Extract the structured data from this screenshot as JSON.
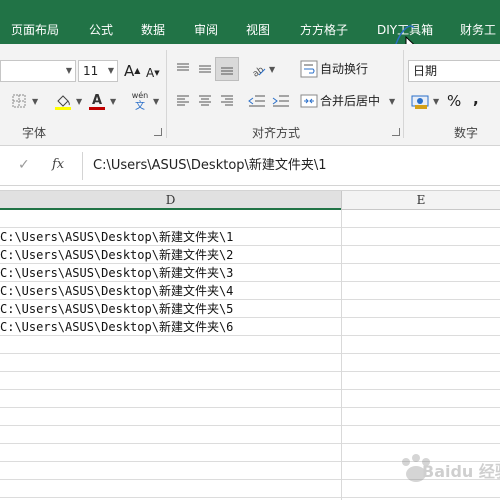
{
  "ribbon_tabs": [
    {
      "label": "页面布局"
    },
    {
      "label": "公式"
    },
    {
      "label": "数据"
    },
    {
      "label": "审阅"
    },
    {
      "label": "视图"
    },
    {
      "label": "方方格子"
    },
    {
      "label": "DIY工具箱"
    },
    {
      "label": "财务工"
    }
  ],
  "font": {
    "size": "11",
    "group_label": "字体",
    "grow_label": "A",
    "shrink_label": "A",
    "font_color_label": "A",
    "phonetic_label": "wén"
  },
  "alignment": {
    "wrap_text_label": "自动换行",
    "merge_center_label": "合并后居中",
    "group_label": "对齐方式"
  },
  "number": {
    "format_value": "日期",
    "percent_label": "%",
    "comma_label": ",",
    "group_label": "数字"
  },
  "formula_bar": {
    "fx_label": "fx",
    "value": "C:\\Users\\ASUS\\Desktop\\新建文件夹\\1"
  },
  "columns": [
    {
      "name": "D",
      "selected": true
    },
    {
      "name": "E",
      "selected": false
    }
  ],
  "rows": [
    {
      "text": "C:\\Users\\ASUS\\Desktop\\新建文件夹\\1"
    },
    {
      "text": "C:\\Users\\ASUS\\Desktop\\新建文件夹\\2"
    },
    {
      "text": "C:\\Users\\ASUS\\Desktop\\新建文件夹\\3"
    },
    {
      "text": "C:\\Users\\ASUS\\Desktop\\新建文件夹\\4"
    },
    {
      "text": "C:\\Users\\ASUS\\Desktop\\新建文件夹\\5"
    },
    {
      "text": "C:\\Users\\ASUS\\Desktop\\新建文件夹\\6"
    }
  ],
  "watermark": {
    "text": "Baidu 经验"
  },
  "colors": {
    "accent": "#217346",
    "font_color_bar": "#c00000",
    "fill_color_bar": "#ffff00"
  }
}
